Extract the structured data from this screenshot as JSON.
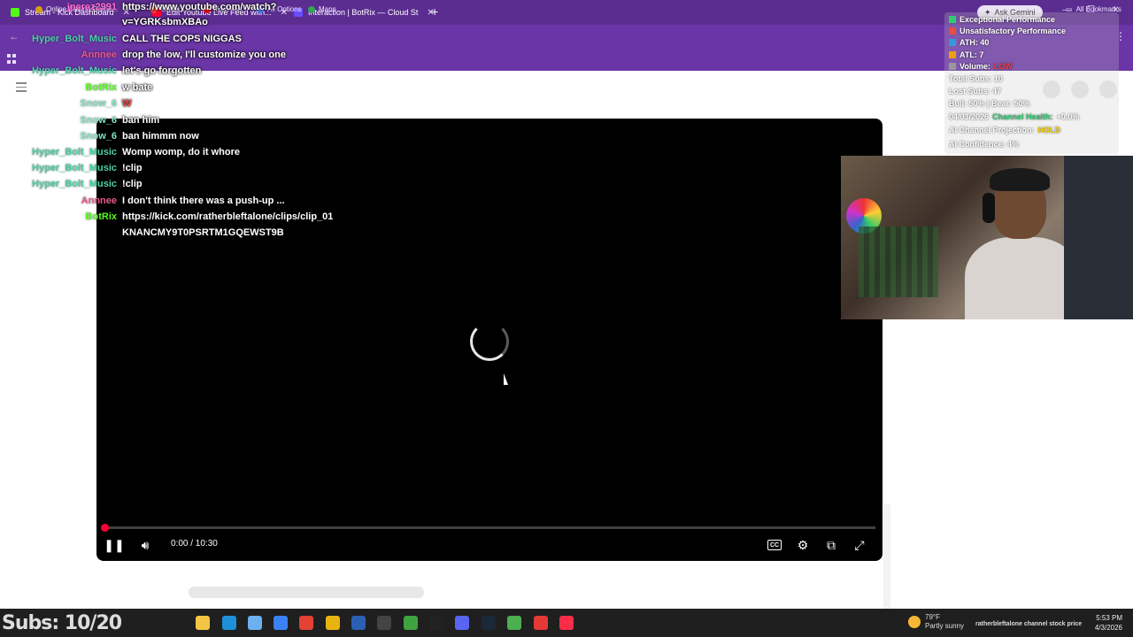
{
  "browser": {
    "tabs": [
      {
        "label": "Stream - Kick Dashboard",
        "color": "#53fc18"
      },
      {
        "label": "Edit Youtube Live Feed with...",
        "color": "#ff0033"
      },
      {
        "label": "Interaction | BotRix — Cloud St",
        "color": "#6a4cff"
      }
    ],
    "ask_gemini": "Ask Gemini",
    "bookmarks": [
      {
        "label": "Online Casino Game...",
        "color": "#d4a017"
      },
      {
        "label": "Gmail",
        "color": "#ea4335"
      },
      {
        "label": "YouTube",
        "color": "#ff0000"
      },
      {
        "label": "All Options",
        "color": "#4285f4"
      },
      {
        "label": "Maps",
        "color": "#34a853"
      }
    ],
    "all_bookmarks": "All Bookmarks"
  },
  "chat": [
    {
      "user": "jperez2991",
      "user_color": "#ff6bd6",
      "message": "https://www.youtube.com/watch?"
    },
    {
      "user": "",
      "user_color": "#ffffff",
      "message": "v=YGRKsbmXBAo"
    },
    {
      "user": "Hyper_Bolt_Music",
      "user_color": "#4ad0a8",
      "message": "CALL THE COPS NIGGAS"
    },
    {
      "user": "Annnee",
      "user_color": "#e85a8c",
      "message": "drop the low, I'll customize you one"
    },
    {
      "user": "Hyper_Bolt_Music",
      "user_color": "#4ad0a8",
      "message": "let's go forgotten"
    },
    {
      "user": "BotRix",
      "user_color": "#53fc18",
      "message": "w bate"
    },
    {
      "user": "Snow_6",
      "user_color": "#7fe6c4",
      "message": "W"
    },
    {
      "user": "Snow_6",
      "user_color": "#7fe6c4",
      "message": "ban him"
    },
    {
      "user": "Snow_6",
      "user_color": "#7fe6c4",
      "message": "ban himmm now"
    },
    {
      "user": "Hyper_Bolt_Music",
      "user_color": "#4ad0a8",
      "message": "Womp womp, do it whore"
    },
    {
      "user": "Hyper_Bolt_Music",
      "user_color": "#4ad0a8",
      "message": "!clip"
    },
    {
      "user": "Hyper_Bolt_Music",
      "user_color": "#4ad0a8",
      "message": "!clip"
    },
    {
      "user": "Annnee",
      "user_color": "#e85a8c",
      "message": "I don't think there was a push-up ..."
    },
    {
      "user": "BotRix",
      "user_color": "#53fc18",
      "message": "https://kick.com/ratherbleftalone/clips/clip_01"
    },
    {
      "user": "",
      "user_color": "#ffffff",
      "message": "KNANCMY9T0PSRTM1GQEWST9B"
    }
  ],
  "stats": {
    "rows": [
      {
        "text": "Exceptional Performance",
        "color": "#2ecc71"
      },
      {
        "text": "Unsatisfactory Performance",
        "color": "#e74c3c"
      },
      {
        "text": "ATH: 40",
        "color": "#3498db"
      },
      {
        "text": "ATL: 7",
        "color": "#f39c12"
      },
      {
        "text": "Volume: ",
        "color": "#999999",
        "highlight": "LOW",
        "highlight_color": "#ff3b3b"
      }
    ],
    "total_subs": "Total Subs: 10",
    "lost_subs": "Lost Subs: 47",
    "bull_bear": "Bull: 50% | Bear: 50%",
    "date": "04/03/2026",
    "channel_health_label": "Channel Health:",
    "channel_health_value": "+0.0%",
    "projection_label": "AI Channel Projection:",
    "projection_value": "HOLD",
    "confidence": "AI Confidence: 4%"
  },
  "player": {
    "time": "0:00 / 10:30",
    "progress_fraction": 0.0
  },
  "subs_goal": "Subs: 10/20",
  "taskbar": {
    "weather_temp": "79°F",
    "weather_desc": "Partly sunny",
    "tray_text": "ratherbleftalone channel stock price",
    "time": "5:53 PM",
    "date": "4/3/2026",
    "icons": [
      {
        "name": "file-explorer-icon",
        "color": "#f4c542"
      },
      {
        "name": "edge-icon",
        "color": "#1e90d8"
      },
      {
        "name": "store-icon",
        "color": "#6bb0f0"
      },
      {
        "name": "photos-icon",
        "color": "#3b82f6"
      },
      {
        "name": "acrobat-icon",
        "color": "#e34234"
      },
      {
        "name": "chrome-icon",
        "color": "#e8b30f"
      },
      {
        "name": "word-icon",
        "color": "#2b5fb3"
      },
      {
        "name": "obs-icon",
        "color": "#444444"
      },
      {
        "name": "xbox-icon",
        "color": "#3fa33f"
      },
      {
        "name": "github-icon",
        "color": "#222222"
      },
      {
        "name": "discord-icon",
        "color": "#5865f2"
      },
      {
        "name": "steam-icon",
        "color": "#1b2838"
      },
      {
        "name": "chrome-active-icon",
        "color": "#4caf50"
      },
      {
        "name": "maps-pin-icon",
        "color": "#e53935"
      },
      {
        "name": "music-icon",
        "color": "#fa2d48"
      }
    ]
  }
}
